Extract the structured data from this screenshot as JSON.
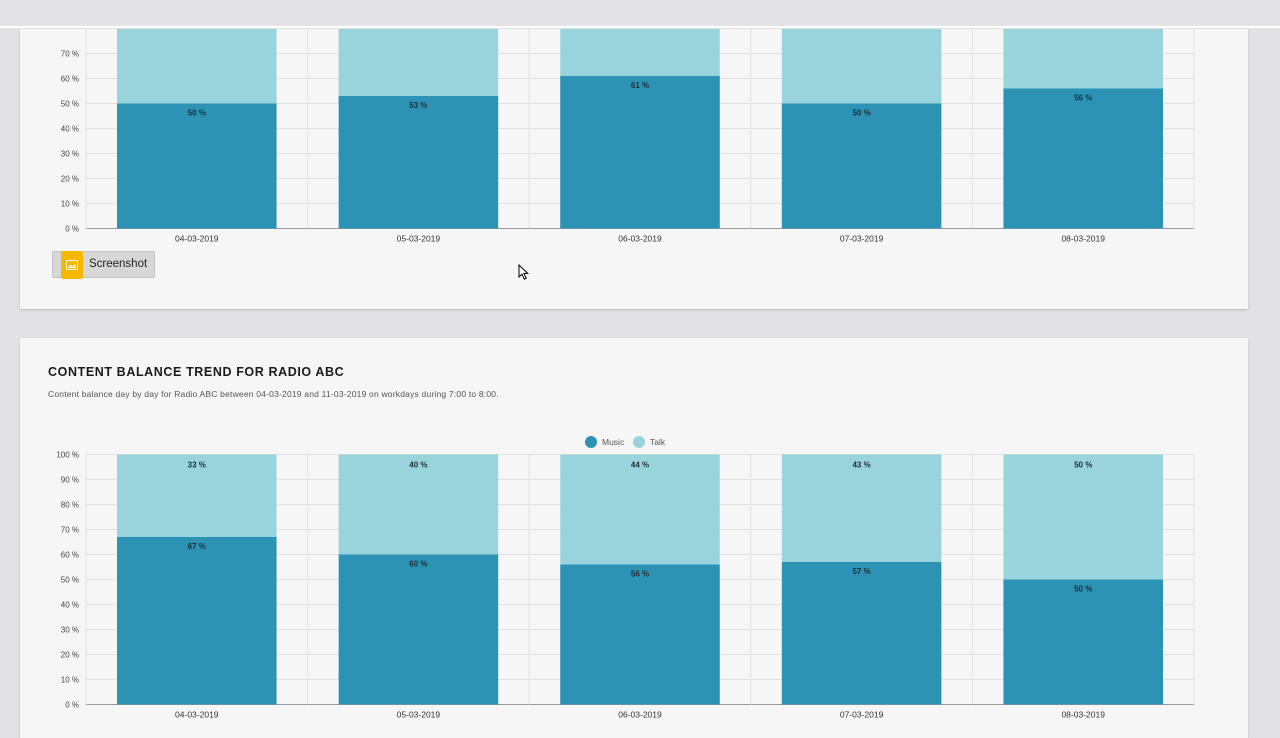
{
  "colors": {
    "music": "#2c93b4",
    "talk": "#99d4dc",
    "screenshot_icon": "#f6b800"
  },
  "top_panel": {
    "screenshot_button": {
      "label": "Screenshot",
      "icon": "image-icon"
    }
  },
  "bottom_panel": {
    "title": "CONTENT BALANCE TREND FOR RADIO ABC",
    "subtitle": "Content balance day by day for Radio ABC between 04-03-2019 and 11-03-2019 on workdays during 7:00 to 8:00."
  },
  "chart_data": [
    {
      "type": "bar",
      "stacked": true,
      "categories": [
        "04-03-2019",
        "05-03-2019",
        "06-03-2019",
        "07-03-2019",
        "08-03-2019"
      ],
      "series": [
        {
          "values": [
            50,
            53,
            61,
            50,
            56
          ]
        },
        {
          "values": [
            50,
            47,
            39,
            50,
            44
          ]
        }
      ],
      "value_labels": [
        "50 %",
        "53 %",
        "61 %",
        "50 %",
        "56 %"
      ],
      "y_ticks": [
        "0 %",
        "10 %",
        "20 %",
        "30 %",
        "40 %",
        "50 %",
        "60 %",
        "70 %"
      ],
      "ylim": [
        0,
        100
      ],
      "grid": true
    },
    {
      "type": "bar",
      "stacked": true,
      "title": "CONTENT BALANCE TREND FOR RADIO ABC",
      "categories": [
        "04-03-2019",
        "05-03-2019",
        "06-03-2019",
        "07-03-2019",
        "08-03-2019"
      ],
      "series": [
        {
          "name": "Music",
          "values": [
            67,
            60,
            56,
            57,
            50
          ],
          "labels": [
            "67 %",
            "60 %",
            "56 %",
            "57 %",
            "50 %"
          ]
        },
        {
          "name": "Talk",
          "values": [
            33,
            40,
            44,
            43,
            50
          ],
          "labels": [
            "33 %",
            "40 %",
            "44 %",
            "43 %",
            "50 %"
          ]
        }
      ],
      "y_ticks": [
        "0 %",
        "10 %",
        "20 %",
        "30 %",
        "40 %",
        "50 %",
        "60 %",
        "70 %",
        "80 %",
        "90 %",
        "100 %"
      ],
      "ylim": [
        0,
        100
      ],
      "grid": true,
      "legend": "top-center"
    }
  ]
}
